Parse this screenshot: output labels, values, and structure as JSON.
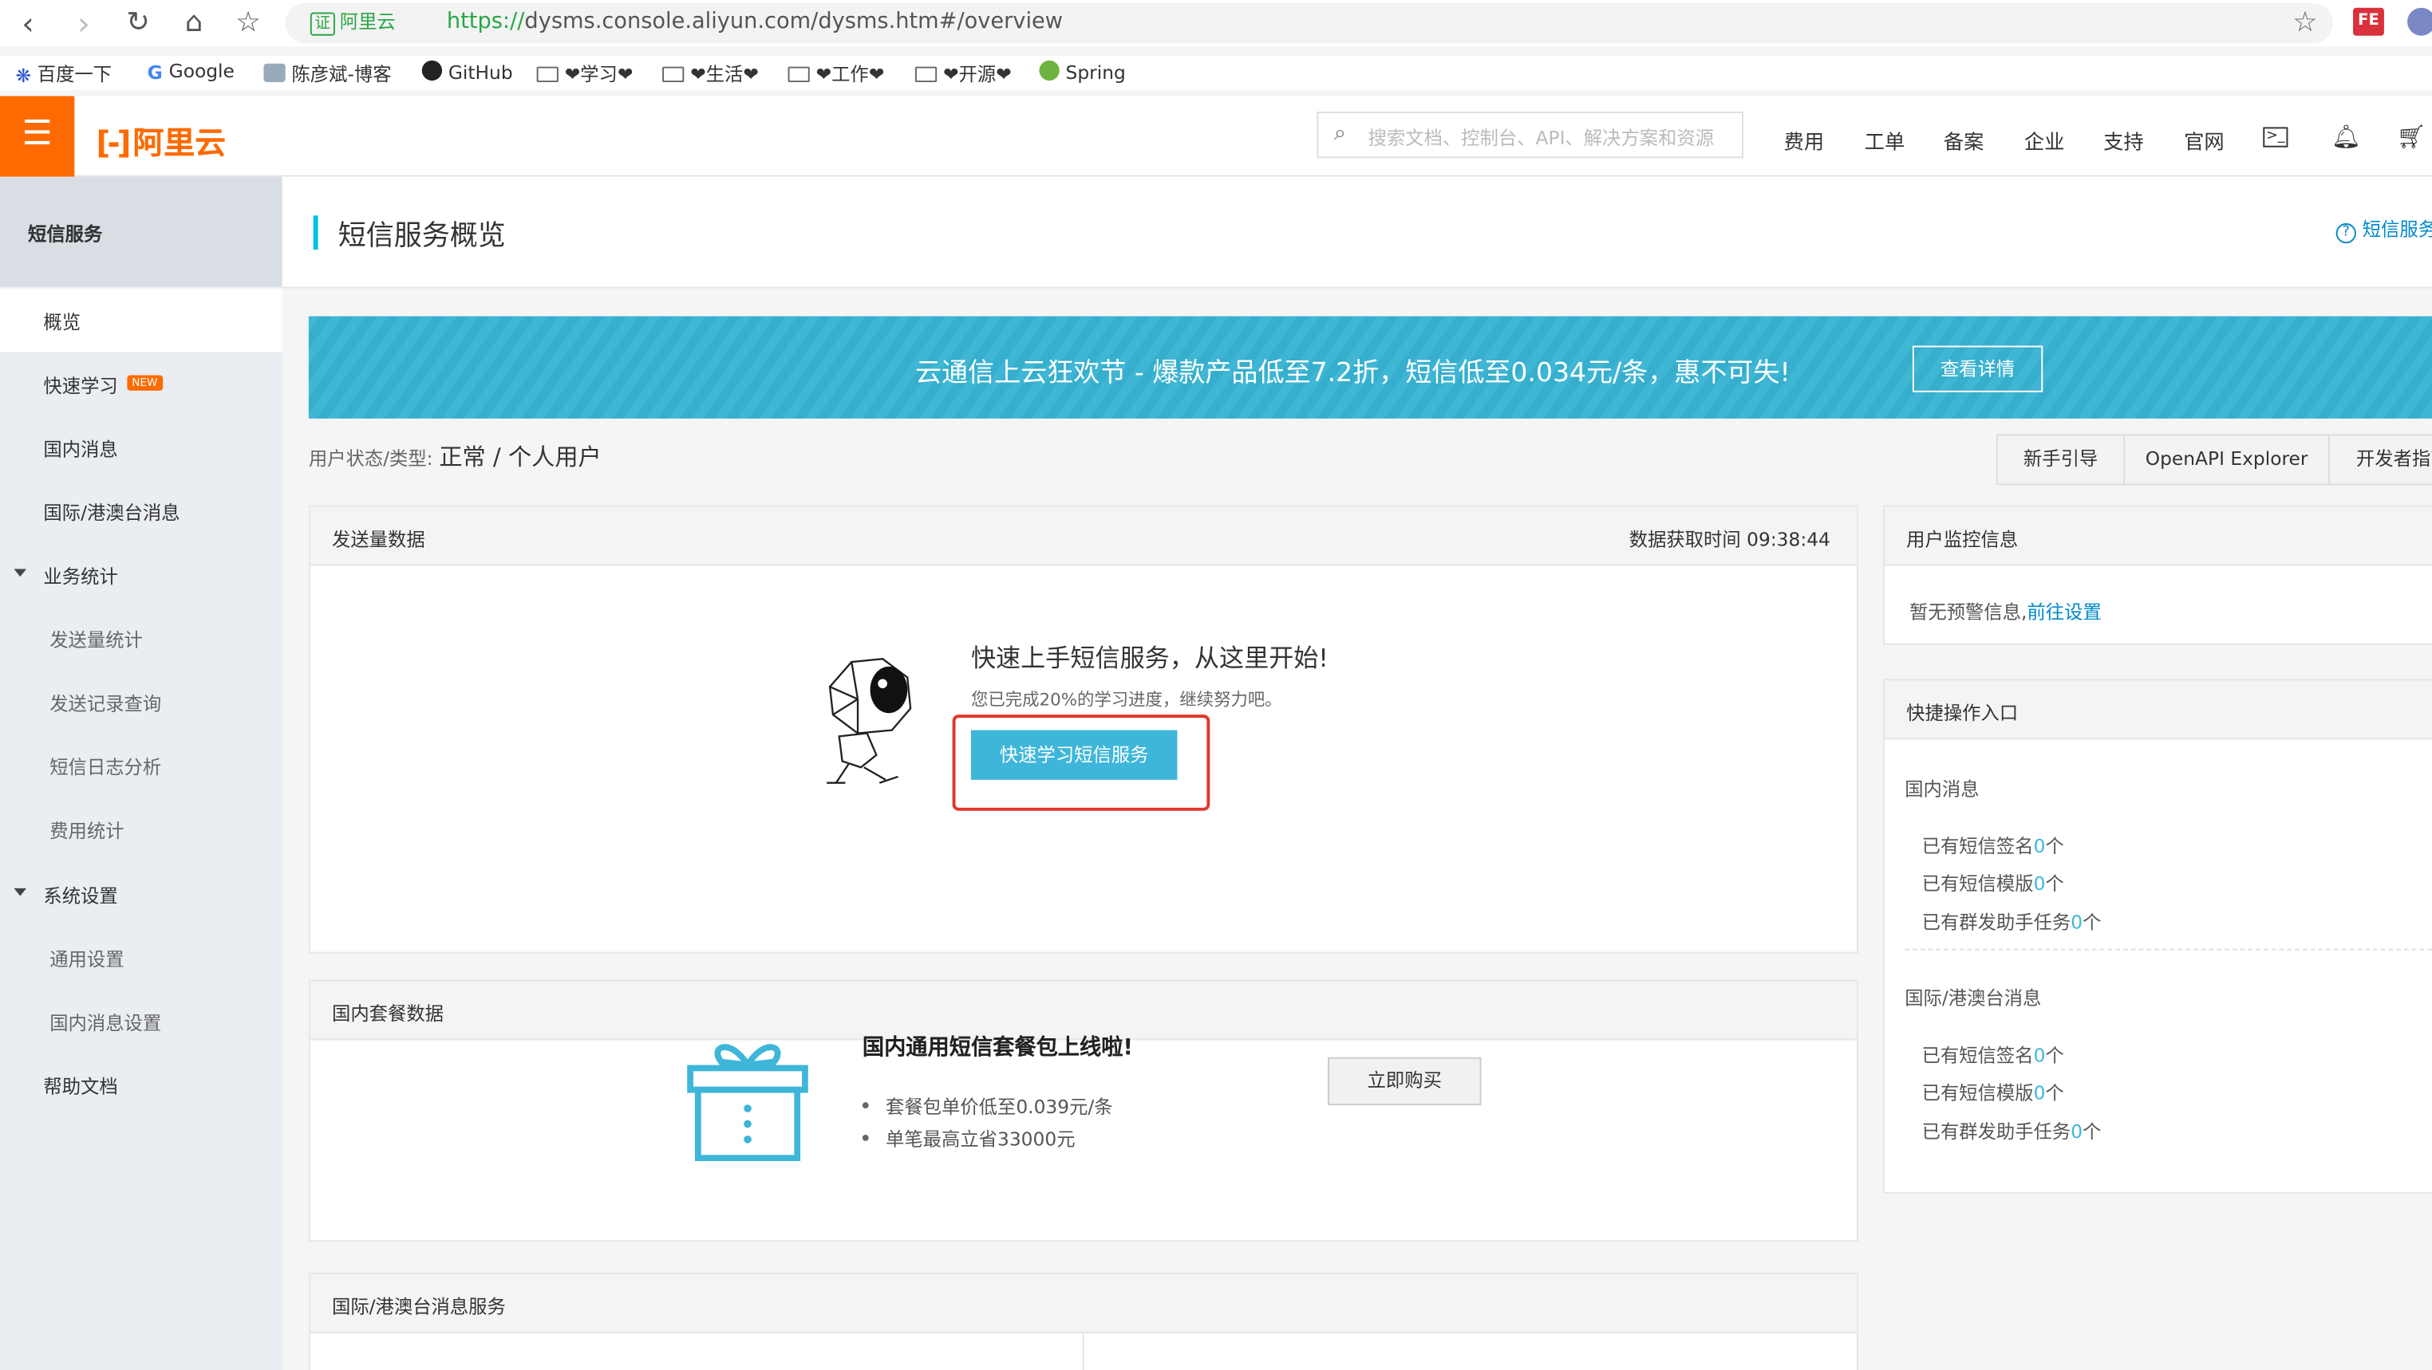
{
  "browser": {
    "url_prefix": "https://",
    "url_rest": "dysms.console.aliyun.com/dysms.htm#/overview",
    "cert_label": "证",
    "cert_name": "阿里云",
    "ext_fe": "FE"
  },
  "bookmarks": [
    {
      "label": "百度一下"
    },
    {
      "label": "Google"
    },
    {
      "label": "陈彦斌-博客"
    },
    {
      "label": "GitHub"
    },
    {
      "label": "❤学习❤"
    },
    {
      "label": "❤生活❤"
    },
    {
      "label": "❤工作❤"
    },
    {
      "label": "❤开源❤"
    },
    {
      "label": "Spring"
    }
  ],
  "topbar": {
    "logo": "阿里云",
    "search_placeholder": "搜索文档、控制台、API、解决方案和资源",
    "nav": [
      "费用",
      "工单",
      "备案",
      "企业",
      "支持",
      "官网"
    ]
  },
  "sidebar": {
    "header": "短信服务",
    "items": [
      {
        "label": "概览"
      },
      {
        "label": "快速学习",
        "badge": "NEW"
      },
      {
        "label": "国内消息"
      },
      {
        "label": "国际/港澳台消息"
      },
      {
        "label": "业务统计"
      },
      {
        "label": "发送量统计"
      },
      {
        "label": "发送记录查询"
      },
      {
        "label": "短信日志分析"
      },
      {
        "label": "费用统计"
      },
      {
        "label": "系统设置"
      },
      {
        "label": "通用设置"
      },
      {
        "label": "国内消息设置"
      },
      {
        "label": "帮助文档"
      }
    ]
  },
  "page": {
    "title": "短信服务概览",
    "help_link": "短信服务",
    "banner_text": "云通信上云狂欢节 - 爆款产品低至7.2折，短信低至0.034元/条，惠不可失!",
    "banner_button": "查看详情",
    "status_label": "用户状态/类型:",
    "status_value": "正常 / 个人用户",
    "right_tabs": [
      "新手引导",
      "OpenAPI Explorer",
      "开发者指南"
    ]
  },
  "send_panel": {
    "title": "发送量数据",
    "time_label": "数据获取时间 09:38:44",
    "promo_title": "快速上手短信服务，从这里开始!",
    "progress_text": "您已完成20%的学习进度，继续努力吧。",
    "progress": 0.2,
    "button": "快速学习短信服务"
  },
  "package_panel": {
    "title": "国内套餐数据",
    "promo_title": "国内通用短信套餐包上线啦!",
    "bullets": [
      "套餐包单价低至0.039元/条",
      "单笔最高立省33000元"
    ],
    "button": "立即购买"
  },
  "intl_panel": {
    "title": "国际/港澳台消息服务"
  },
  "monitor_panel": {
    "title": "用户监控信息",
    "text": "暂无预警信息,",
    "link": "前往设置"
  },
  "quick_panel": {
    "title": "快捷操作入口",
    "sections": [
      {
        "title": "国内消息",
        "items": [
          {
            "prefix": "已有短信签名",
            "count": "0",
            "suffix": "个"
          },
          {
            "prefix": "已有短信模版",
            "count": "0",
            "suffix": "个"
          },
          {
            "prefix": "已有群发助手任务",
            "count": "0",
            "suffix": "个"
          }
        ]
      },
      {
        "title": "国际/港澳台消息",
        "items": [
          {
            "prefix": "已有短信签名",
            "count": "0",
            "suffix": "个"
          },
          {
            "prefix": "已有短信模版",
            "count": "0",
            "suffix": "个"
          },
          {
            "prefix": "已有群发助手任务",
            "count": "0",
            "suffix": "个"
          }
        ]
      }
    ]
  },
  "colors": {
    "brand_orange": "#ff6a00",
    "accent_blue": "#3eb6d9",
    "link_blue": "#0088cc",
    "highlight_red": "#e0362b"
  }
}
